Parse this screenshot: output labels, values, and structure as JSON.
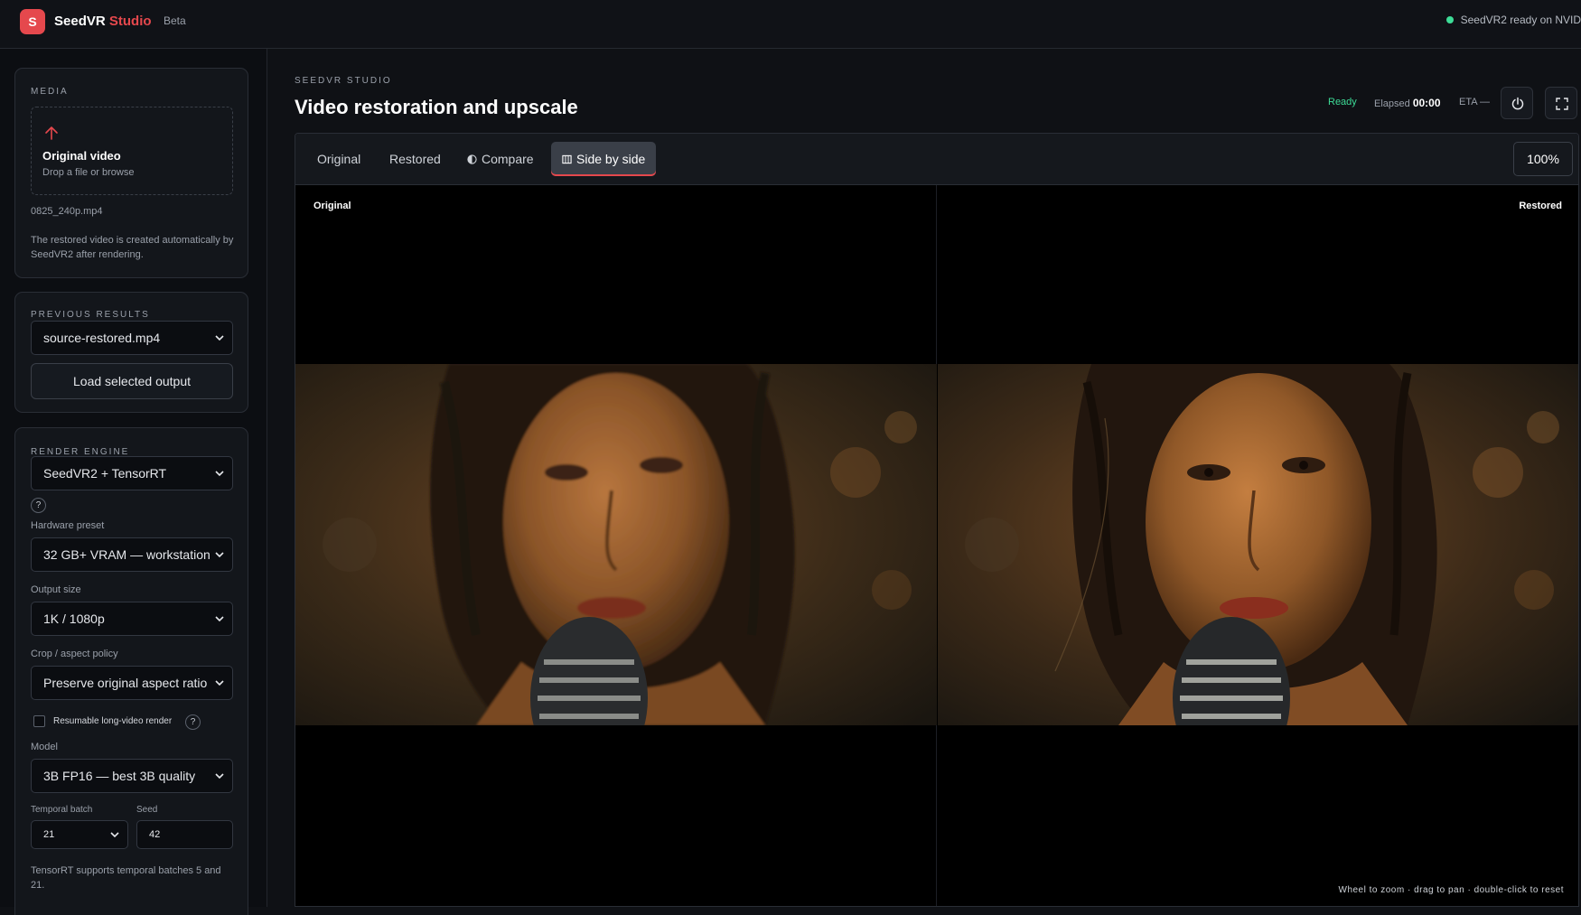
{
  "header": {
    "logo_letter": "S",
    "brand_name": "SeedVR",
    "brand_accent": "Studio",
    "badge": "Beta",
    "status": "SeedVR2 ready on NVID"
  },
  "sidebar": {
    "media": {
      "label": "MEDIA",
      "dropzone_title": "Original video",
      "dropzone_sub": "Drop a file or browse",
      "filename": "0825_240p.mp4",
      "note": "The restored video is created automatically by SeedVR2 after rendering."
    },
    "previous": {
      "label": "PREVIOUS RESULTS",
      "selected": "source-restored.mp4",
      "load_button": "Load selected output"
    },
    "render": {
      "label": "RENDER ENGINE",
      "engine": "SeedVR2 + TensorRT",
      "help": "?",
      "hardware_label": "Hardware preset",
      "hardware": "32 GB+ VRAM — workstation",
      "output_label": "Output size",
      "output": "1K / 1080p",
      "crop_label": "Crop / aspect policy",
      "crop": "Preserve original aspect ratio",
      "resumable_label": "Resumable long-video render",
      "resumable_checked": false,
      "model_label": "Model",
      "model": "3B FP16 — best 3B quality",
      "batch_label": "Temporal batch",
      "batch": "21",
      "seed_label": "Seed",
      "seed": "42",
      "footnote": "TensorRT supports temporal batches 5 and 21."
    }
  },
  "main": {
    "kicker": "SEEDVR STUDIO",
    "title": "Video restoration and upscale",
    "status": "Ready",
    "elapsed_label": "Elapsed",
    "elapsed": "00:00",
    "eta": "ETA —",
    "tabs": [
      {
        "label": "Original"
      },
      {
        "label": "Restored"
      },
      {
        "label": "Compare"
      },
      {
        "label": "Side by side",
        "active": true
      }
    ],
    "zoom": "100%",
    "left_label": "Original",
    "right_label": "Restored",
    "hint": "Wheel to zoom · drag to pan · double-click to reset"
  },
  "colors": {
    "accent": "#e5484d",
    "ready": "#3ddc97",
    "background": "#0f1115"
  }
}
